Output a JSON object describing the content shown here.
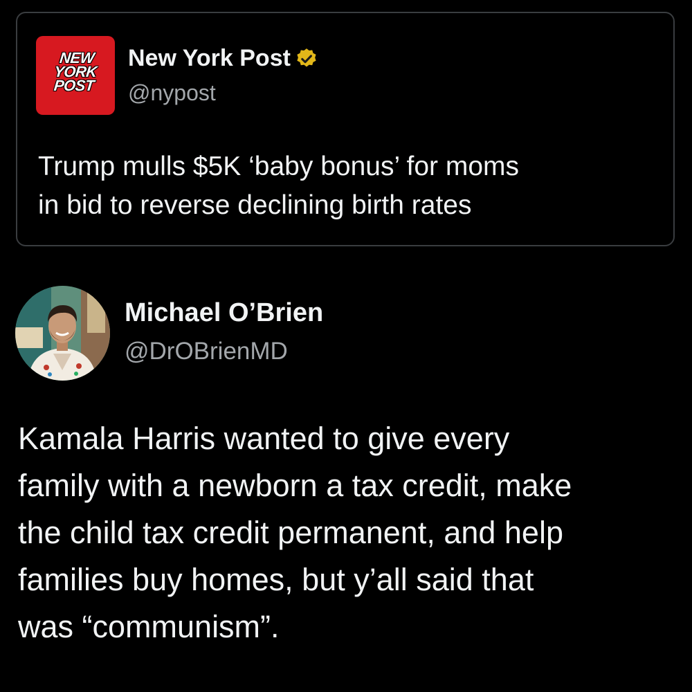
{
  "quoted_tweet": {
    "logo_lines": [
      "NEW",
      "YORK",
      "POST"
    ],
    "display_name": "New York Post",
    "handle": "@nypost",
    "verified": true,
    "text_lines": [
      "Trump mulls $5K ‘baby bonus’ for moms",
      "in bid to reverse declining birth rates"
    ]
  },
  "tweet": {
    "display_name": "Michael O’Brien",
    "handle": "@DrOBrienMD",
    "text_lines": [
      "Kamala Harris wanted to give every",
      "family with a newborn a tax credit, make",
      "the child tax credit permanent, and help",
      "families buy homes, but y’all said that",
      "was “communism”."
    ]
  },
  "colors": {
    "background": "#000000",
    "logo_red": "#d71920",
    "verified_gold": "#e2b719",
    "text_primary": "#f1f3f4",
    "text_secondary": "#a3a7ab",
    "card_border": "#3a3d40"
  },
  "icons": {
    "verified": "verified-badge-icon"
  }
}
